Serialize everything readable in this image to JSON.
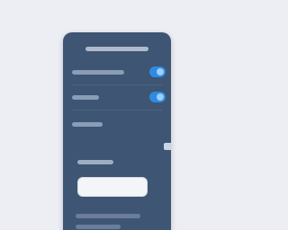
{
  "colors": {
    "background": "#eceef3",
    "panel": "#3e5573",
    "accent": "#2f8be0",
    "input_fill": "#f3f5f8"
  },
  "icons": {
    "toggle_1": "toggle-switch-icon",
    "toggle_2": "toggle-switch-icon"
  },
  "settings": {
    "toggles": [
      {
        "on": true
      },
      {
        "on": true
      }
    ]
  }
}
